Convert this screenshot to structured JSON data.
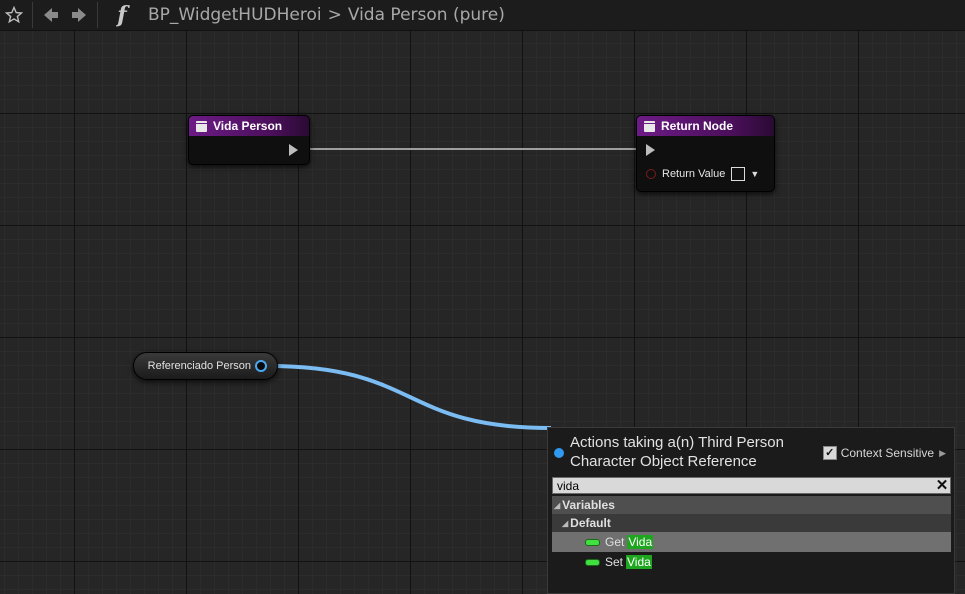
{
  "toolbar": {
    "icons": [
      "star-icon",
      "back-arrow-icon",
      "forward-arrow-icon",
      "function-icon"
    ],
    "function_glyph": "f",
    "breadcrumb": {
      "blueprint": "BP_WidgetHUDHeroi",
      "separator": ">",
      "function": "Vida Person (pure)"
    }
  },
  "graph": {
    "entry_node": {
      "title": "Vida Person"
    },
    "return_node": {
      "title": "Return Node",
      "pin_label": "Return Value"
    },
    "variable_node": {
      "label": "Referenciado Person"
    },
    "colors": {
      "function_header": "#6d1b86",
      "object_wire": "#4aa8f0",
      "exec_wire": "#9e9e9e"
    }
  },
  "action_menu": {
    "title": "Actions taking a(n) Third Person Character Object Reference",
    "context_sensitive_label": "Context Sensitive",
    "context_sensitive_checked": true,
    "search_value": "vida",
    "categories": [
      {
        "label": "Variables",
        "level": 1
      },
      {
        "label": "Default",
        "level": 2
      }
    ],
    "items": [
      {
        "prefix": "Get",
        "match": "Vida",
        "selected": true
      },
      {
        "prefix": "Set",
        "match": "Vida",
        "selected": false
      }
    ],
    "colors": {
      "match_highlight": "#1fa61f",
      "variable_icon": "#3fe03f"
    }
  }
}
